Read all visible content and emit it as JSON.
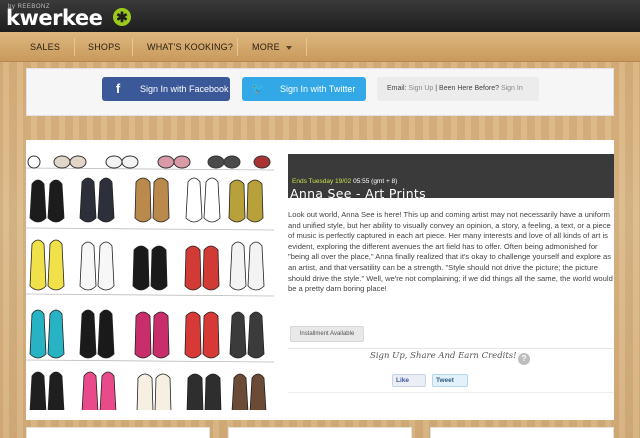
{
  "header": {
    "brand_small": "by REEBONZ",
    "brand": "kwerkee",
    "brand_mark": "✱"
  },
  "nav": {
    "items": [
      {
        "label": "SALES"
      },
      {
        "label": "SHOPS"
      },
      {
        "label": "WHAT'S KOOKING?"
      },
      {
        "label": "MORE"
      }
    ]
  },
  "signin": {
    "facebook_label": "Sign In with Facebook",
    "facebook_icon": "f",
    "twitter_label": "Sign In with Twitter",
    "twitter_icon": "🐦",
    "email_prefix": "Email:",
    "sign_up": "Sign Up",
    "separator": "|",
    "been_here": "Been Here Before?",
    "sign_in": "Sign In"
  },
  "deal": {
    "ends_label": "Ends Tuesday 19/02",
    "ends_time": "05:55 (gmt + 8)",
    "title": "Anna See - Art Prints",
    "description": "Look out world, Anna See is here! This up and coming artist may not necessarily have a uniform and unified style, but her ability to visually convey an opinion, a story, a feeling, a text, or a piece of music is perfectly captured in each art piece. Her many interests and love of all kinds of art is evident, exploring the different avenues the art field has to offer. Often being admonished for \"being all over the place,\" Anna finally realized that it's okay to challenge yourself and explore as an artist, and that versatility can be a strength. \"Style should not drive the picture; the picture should drive the style.\" Well, we're not complaining; if we did things all the same, the world would be a pretty darn boring place!",
    "installment": "Installment Available",
    "share_text": "Sign Up, Share And Earn Credits!",
    "help": "?",
    "like": "Like",
    "tweet": "Tweet"
  },
  "colors": {
    "facebook": "#3b5998",
    "twitter": "#33a8e6",
    "accent_green": "#9ccb1c",
    "ends_highlight": "#c8e04a"
  }
}
